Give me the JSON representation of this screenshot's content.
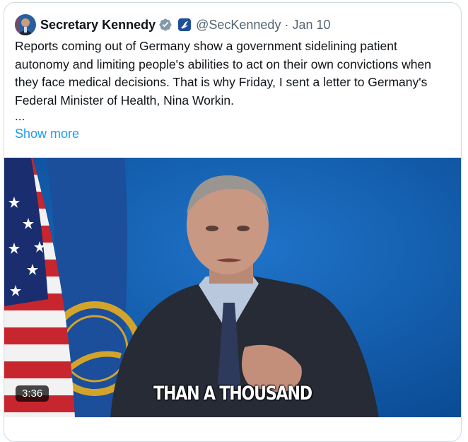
{
  "tweet": {
    "author_name": "Secretary Kennedy",
    "handle": "@SecKennedy",
    "separator": "·",
    "date": "Jan 10",
    "text": "Reports coming out of Germany show a government sidelining patient autonomy and limiting people's abilities to act on their own convictions when they face medical decisions. That is why Friday, I sent a letter to Germany's Federal Minister of Health, Nina Workin.",
    "ellipsis": "...",
    "show_more": "Show more"
  },
  "video": {
    "caption": "THAN A THOUSAND",
    "duration": "3:36"
  },
  "colors": {
    "link": "#1d9bf0",
    "verified_badge": "#829aab",
    "affiliation_badge": "#1d4f9c",
    "video_background": "#0d58a8"
  },
  "icons": [
    "verified-badge-icon",
    "hhs-affiliation-icon"
  ]
}
